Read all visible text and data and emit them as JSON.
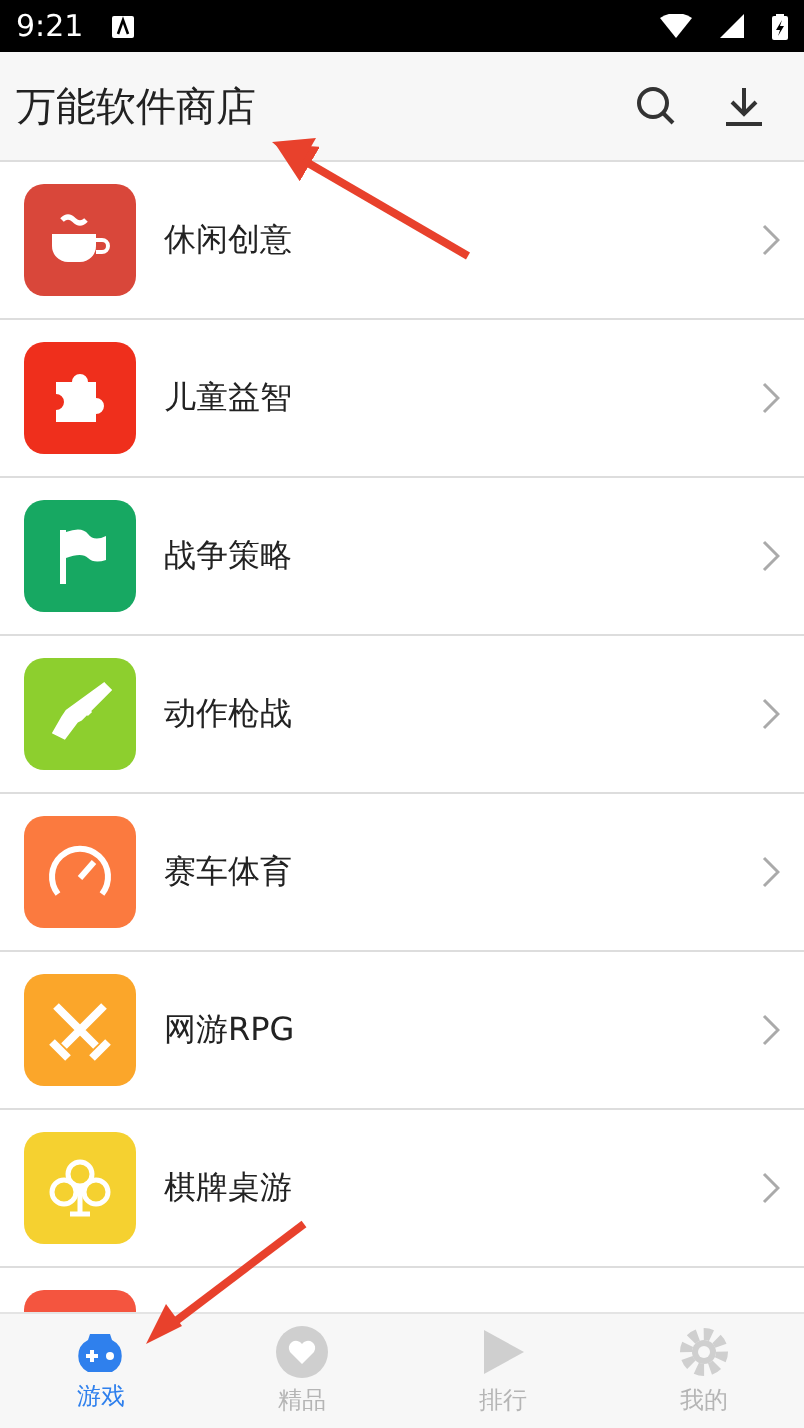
{
  "status_bar": {
    "time": "9:21"
  },
  "app_bar": {
    "title": "万能软件商店"
  },
  "categories": [
    {
      "name": "休闲创意",
      "kind": "cup",
      "color": "#d9473a"
    },
    {
      "name": "儿童益智",
      "kind": "puzzle",
      "color": "#ef2f1c"
    },
    {
      "name": "战争策略",
      "kind": "flag",
      "color": "#17a862"
    },
    {
      "name": "动作枪战",
      "kind": "gun",
      "color": "#8dcf2e"
    },
    {
      "name": "赛车体育",
      "kind": "gauge",
      "color": "#fb7a3f"
    },
    {
      "name": "网游RPG",
      "kind": "swords",
      "color": "#fba62a"
    },
    {
      "name": "棋牌桌游",
      "kind": "club",
      "color": "#f5d130"
    },
    {
      "kind": "blank",
      "color": "#f4553f"
    }
  ],
  "tabs": [
    {
      "label": "游戏",
      "kind": "gamepad",
      "selected": true
    },
    {
      "label": "精品",
      "kind": "heart",
      "selected": false
    },
    {
      "label": "排行",
      "kind": "rank",
      "selected": false
    },
    {
      "label": "我的",
      "kind": "gear",
      "selected": false
    }
  ]
}
